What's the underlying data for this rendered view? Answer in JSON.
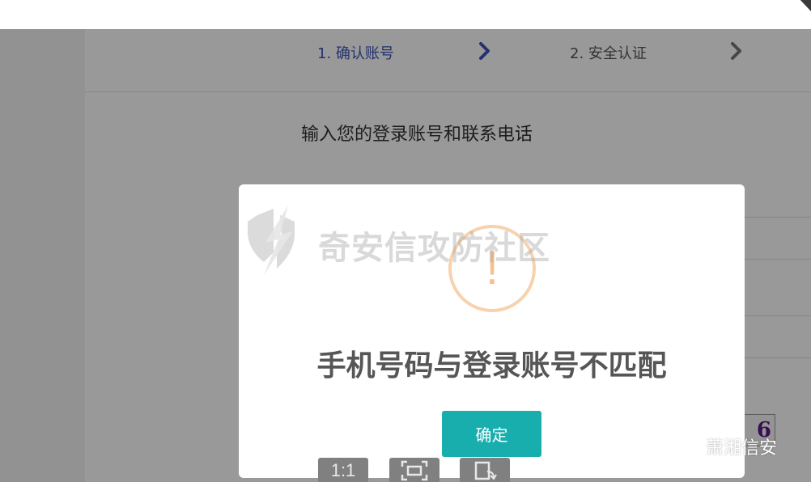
{
  "steps": [
    {
      "label": "1. 确认账号",
      "state": "active"
    },
    {
      "label": "2. 安全认证",
      "state": "inactive"
    }
  ],
  "form": {
    "title": "输入您的登录账号和联系电话",
    "captcha_char": "6"
  },
  "dialog": {
    "icon": "warning-exclamation-icon",
    "icon_glyph": "!",
    "message": "手机号码与登录账号不匹配",
    "confirm_label": "确定"
  },
  "watermark": {
    "text": "奇安信攻防社区"
  },
  "viewer_toolbar": {
    "actual_size_label": "1:1"
  },
  "badge": {
    "text": "萧湘信安"
  },
  "colors": {
    "accent_step": "#3c52b8",
    "confirm_button": "#18aeae",
    "warning": "#f5c08e"
  }
}
